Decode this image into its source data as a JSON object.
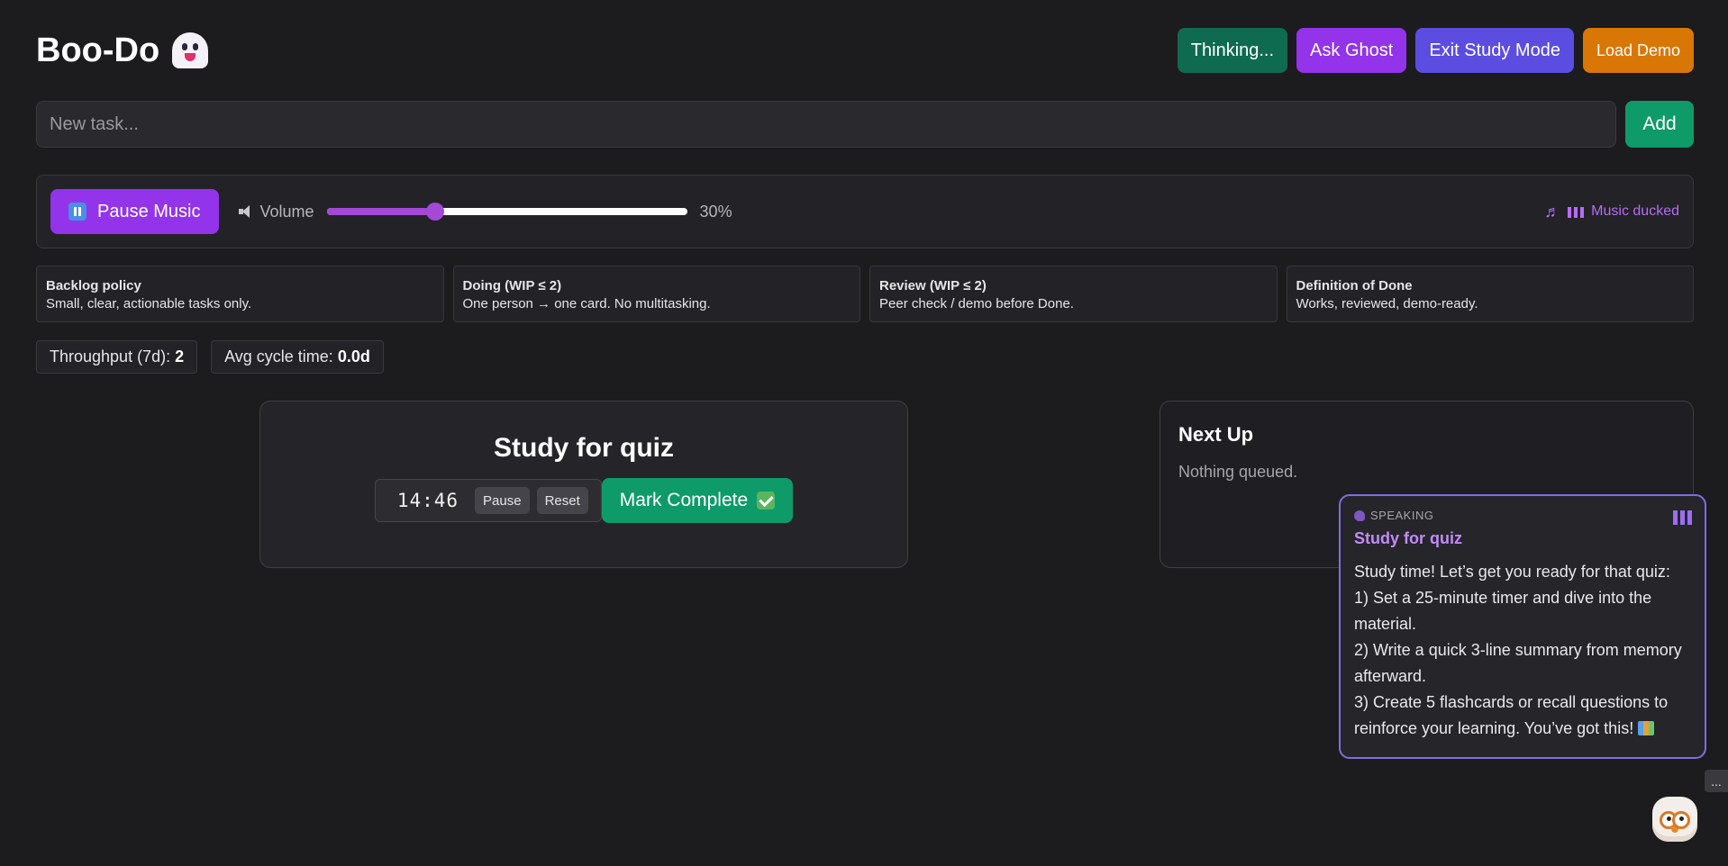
{
  "app": {
    "title": "Boo-Do"
  },
  "header": {
    "thinking_label": "Thinking...",
    "ask_label": "Ask Ghost",
    "exit_label": "Exit Study Mode",
    "demo_label": "Load Demo"
  },
  "task_entry": {
    "placeholder": "New task...",
    "value": "",
    "add_label": "Add"
  },
  "music": {
    "button_label": "Pause Music",
    "volume_label": "Volume",
    "volume_percent": 30,
    "volume_text": "30%",
    "status_text": "Music ducked"
  },
  "policies": [
    {
      "title": "Backlog policy",
      "text": "Small, clear, actionable tasks only."
    },
    {
      "title": "Doing (WIP ≤ 2)",
      "text": "One person → one card. No multitasking."
    },
    {
      "title": "Review (WIP ≤ 2)",
      "text": "Peer check / demo before Done."
    },
    {
      "title": "Definition of Done",
      "text": "Works, reviewed, demo-ready."
    }
  ],
  "stats": {
    "throughput_label": "Throughput (7d): ",
    "throughput_value": "2",
    "cycle_label": "Avg cycle time: ",
    "cycle_value": "0.0d"
  },
  "focus": {
    "title": "Study for quiz",
    "timer": "14:46",
    "pause_label": "Pause",
    "reset_label": "Reset",
    "complete_label": "Mark Complete"
  },
  "next_up": {
    "title": "Next Up",
    "empty_text": "Nothing queued."
  },
  "ghost_bubble": {
    "status": "SPEAKING",
    "title": "Study for quiz",
    "lines": [
      "Study time! Let’s get you ready for that quiz:",
      "1) Set a 25-minute timer and dive into the material.",
      "2) Write a quick 3-line summary from memory afterward.",
      "3) Create 5 flashcards or recall questions to reinforce your learning. You’ve got this!"
    ]
  },
  "more_label": "...",
  "colors": {
    "background": "#1c1b1e",
    "accent_purple": "#9333ea",
    "accent_green": "#0f9a6a",
    "accent_indigo": "#5b4de0",
    "accent_orange": "#d97706",
    "volume_fill": "#a349d6"
  },
  "icons": {
    "title_icon": "ghost-icon",
    "music_button_icon": "pause-icon",
    "volume_icon": "speaker-icon",
    "music_status_icons": [
      "music-note-icon",
      "equalizer-bars-icon"
    ],
    "complete_icon": "checkmark-icon",
    "bubble_icons": [
      "speaking-icon",
      "equalizer-bars-icon",
      "books-icon"
    ],
    "mascot": "owl-mascot-icon"
  }
}
